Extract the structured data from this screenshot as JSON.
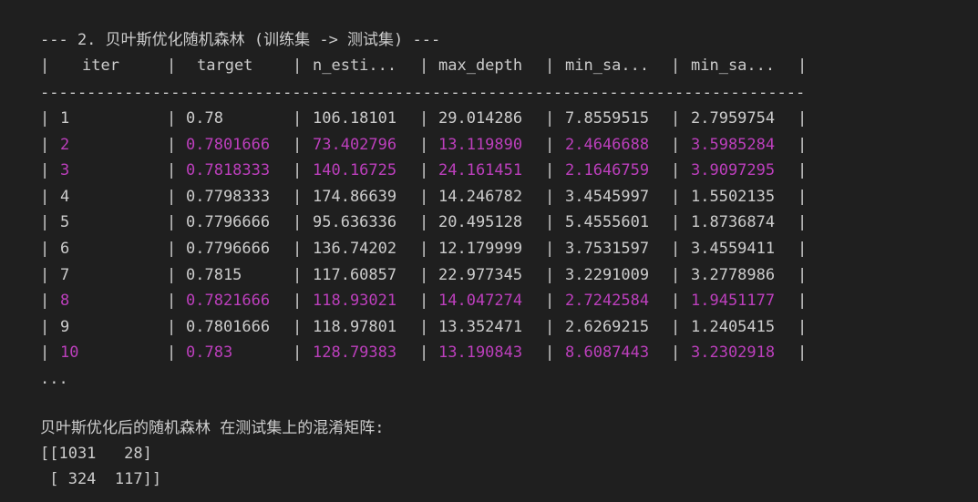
{
  "section_title": "--- 2. 贝叶斯优化随机森林 (训练集 -> 测试集) ---",
  "table": {
    "headers": [
      "iter",
      "target",
      "n_esti...",
      "max_depth",
      "min_sa...",
      "min_sa..."
    ],
    "divider": "-------------------------------------------------------------------------------------------------------------",
    "rows": [
      {
        "iter": "1",
        "target": "0.78",
        "n_estimators": "106.18101",
        "max_depth": "29.014286",
        "min_sa1": "7.8559515",
        "min_sa2": "2.7959754",
        "highlighted": false
      },
      {
        "iter": "2",
        "target": "0.7801666",
        "n_estimators": "73.402796",
        "max_depth": "13.119890",
        "min_sa1": "2.4646688",
        "min_sa2": "3.5985284",
        "highlighted": true
      },
      {
        "iter": "3",
        "target": "0.7818333",
        "n_estimators": "140.16725",
        "max_depth": "24.161451",
        "min_sa1": "2.1646759",
        "min_sa2": "3.9097295",
        "highlighted": true
      },
      {
        "iter": "4",
        "target": "0.7798333",
        "n_estimators": "174.86639",
        "max_depth": "14.246782",
        "min_sa1": "3.4545997",
        "min_sa2": "1.5502135",
        "highlighted": false
      },
      {
        "iter": "5",
        "target": "0.7796666",
        "n_estimators": "95.636336",
        "max_depth": "20.495128",
        "min_sa1": "5.4555601",
        "min_sa2": "1.8736874",
        "highlighted": false
      },
      {
        "iter": "6",
        "target": "0.7796666",
        "n_estimators": "136.74202",
        "max_depth": "12.179999",
        "min_sa1": "3.7531597",
        "min_sa2": "3.4559411",
        "highlighted": false
      },
      {
        "iter": "7",
        "target": "0.7815",
        "n_estimators": "117.60857",
        "max_depth": "22.977345",
        "min_sa1": "3.2291009",
        "min_sa2": "3.2778986",
        "highlighted": false
      },
      {
        "iter": "8",
        "target": "0.7821666",
        "n_estimators": "118.93021",
        "max_depth": "14.047274",
        "min_sa1": "2.7242584",
        "min_sa2": "1.9451177",
        "highlighted": true
      },
      {
        "iter": "9",
        "target": "0.7801666",
        "n_estimators": "118.97801",
        "max_depth": "13.352471",
        "min_sa1": "2.6269215",
        "min_sa2": "1.2405415",
        "highlighted": false
      },
      {
        "iter": "10",
        "target": "0.783",
        "n_estimators": "128.79383",
        "max_depth": "13.190843",
        "min_sa1": "8.6087443",
        "min_sa2": "3.2302918",
        "highlighted": true
      }
    ],
    "ellipsis": "..."
  },
  "confusion_matrix": {
    "caption": "贝叶斯优化后的随机森林 在测试集上的混淆矩阵:",
    "line1": "[[1031   28]",
    "line2": " [ 324  117]]"
  },
  "colors": {
    "background": "#1f1f1f",
    "text": "#cccccc",
    "highlight": "#bc3fbc"
  }
}
